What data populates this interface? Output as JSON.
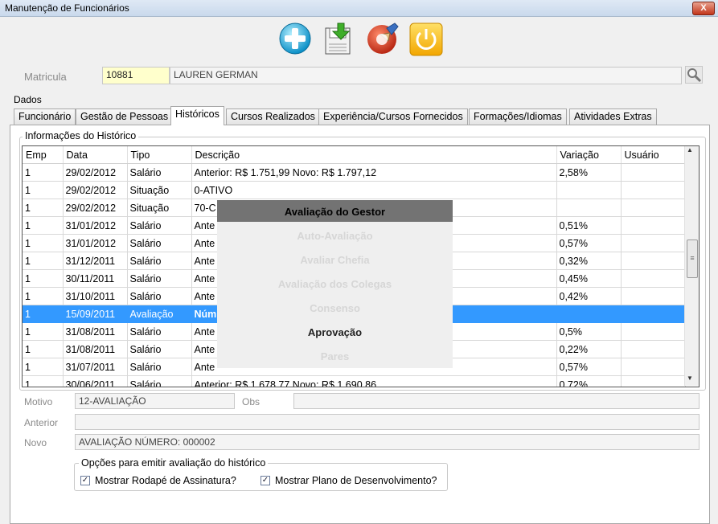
{
  "window": {
    "title": "Manutenção de Funcionários",
    "close_label": "X"
  },
  "toolbar": {
    "icons": [
      "add-icon",
      "download-save-icon",
      "clear-brush-icon",
      "power-icon"
    ]
  },
  "employee": {
    "label": "Matricula",
    "id": "10881",
    "name": "LAUREN GERMAN"
  },
  "dados_label": "Dados",
  "tabs": [
    "Funcionário",
    "Gestão de Pessoas",
    "Históricos",
    "Cursos Realizados",
    "Experiência/Cursos Fornecidos",
    "Formações/Idiomas",
    "Atividades Extras"
  ],
  "active_tab": "Históricos",
  "history": {
    "group_label": "Informações do Histórico",
    "columns": [
      "Emp",
      "Data",
      "Tipo",
      "Descrição",
      "Variação",
      "Usuário"
    ],
    "rows": [
      {
        "emp": "1",
        "data": "29/02/2012",
        "tipo": "Salário",
        "desc": "Anterior: R$ 1.751,99      Novo: R$ 1.797,12",
        "var": "2,58%",
        "user": ""
      },
      {
        "emp": "1",
        "data": "29/02/2012",
        "tipo": "Situação",
        "desc": "0-ATIVO",
        "var": "",
        "user": ""
      },
      {
        "emp": "1",
        "data": "29/02/2012",
        "tipo": "Situação",
        "desc": "70-C",
        "var": "",
        "user": ""
      },
      {
        "emp": "1",
        "data": "31/01/2012",
        "tipo": "Salário",
        "desc": "Ante",
        "var": "0,51%",
        "user": ""
      },
      {
        "emp": "1",
        "data": "31/01/2012",
        "tipo": "Salário",
        "desc": "Ante",
        "var": "0,57%",
        "user": ""
      },
      {
        "emp": "1",
        "data": "31/12/2011",
        "tipo": "Salário",
        "desc": "Ante",
        "var": "0,32%",
        "user": ""
      },
      {
        "emp": "1",
        "data": "30/11/2011",
        "tipo": "Salário",
        "desc": "Ante",
        "var": "0,45%",
        "user": ""
      },
      {
        "emp": "1",
        "data": "31/10/2011",
        "tipo": "Salário",
        "desc": "Ante",
        "var": "0,42%",
        "user": ""
      },
      {
        "emp": "1",
        "data": "15/09/2011",
        "tipo": "Avaliação",
        "desc": "Núm",
        "var": "",
        "user": "",
        "selected": true
      },
      {
        "emp": "1",
        "data": "31/08/2011",
        "tipo": "Salário",
        "desc": "Ante",
        "var": "0,5%",
        "user": ""
      },
      {
        "emp": "1",
        "data": "31/08/2011",
        "tipo": "Salário",
        "desc": "Ante",
        "var": "0,22%",
        "user": ""
      },
      {
        "emp": "1",
        "data": "31/07/2011",
        "tipo": "Salário",
        "desc": "Ante",
        "var": "0,57%",
        "user": ""
      },
      {
        "emp": "1",
        "data": "30/06/2011",
        "tipo": "Salário",
        "desc": "Anterior: R$ 1.678,77      Novo: R$ 1.690,86",
        "var": "0,72%",
        "user": ""
      }
    ]
  },
  "details": {
    "motivo_label": "Motivo",
    "motivo_value": "12-AVALIAÇÃO",
    "obs_label": "Obs",
    "obs_value": "",
    "anterior_label": "Anterior",
    "anterior_value": "",
    "novo_label": "Novo",
    "novo_value": "AVALIAÇÃO NÚMERO: 000002"
  },
  "options": {
    "group_label": "Opções para emitir avaliação do histórico",
    "rodape_label": "Mostrar Rodapé de Assinatura?",
    "rodape_checked": true,
    "plano_label": "Mostrar Plano de Desenvolvimento?",
    "plano_checked": true,
    "check_mark": "✓"
  },
  "popup": {
    "title": "Avaliação do Gestor",
    "items": [
      {
        "label": "Auto-Avaliação",
        "enabled": false
      },
      {
        "label": "Avaliar Chefia",
        "enabled": false
      },
      {
        "label": "Avaliação dos Colegas",
        "enabled": false
      },
      {
        "label": "Consenso",
        "enabled": false
      },
      {
        "label": "Aprovação",
        "enabled": true
      },
      {
        "label": "Pares",
        "enabled": false
      }
    ]
  },
  "scrollbar": {
    "up": "▲",
    "down": "▼",
    "grip": "≡"
  },
  "colors": {
    "selection": "#3399ff",
    "popup_header": "#737373",
    "id_highlight": "#ffffcc"
  }
}
